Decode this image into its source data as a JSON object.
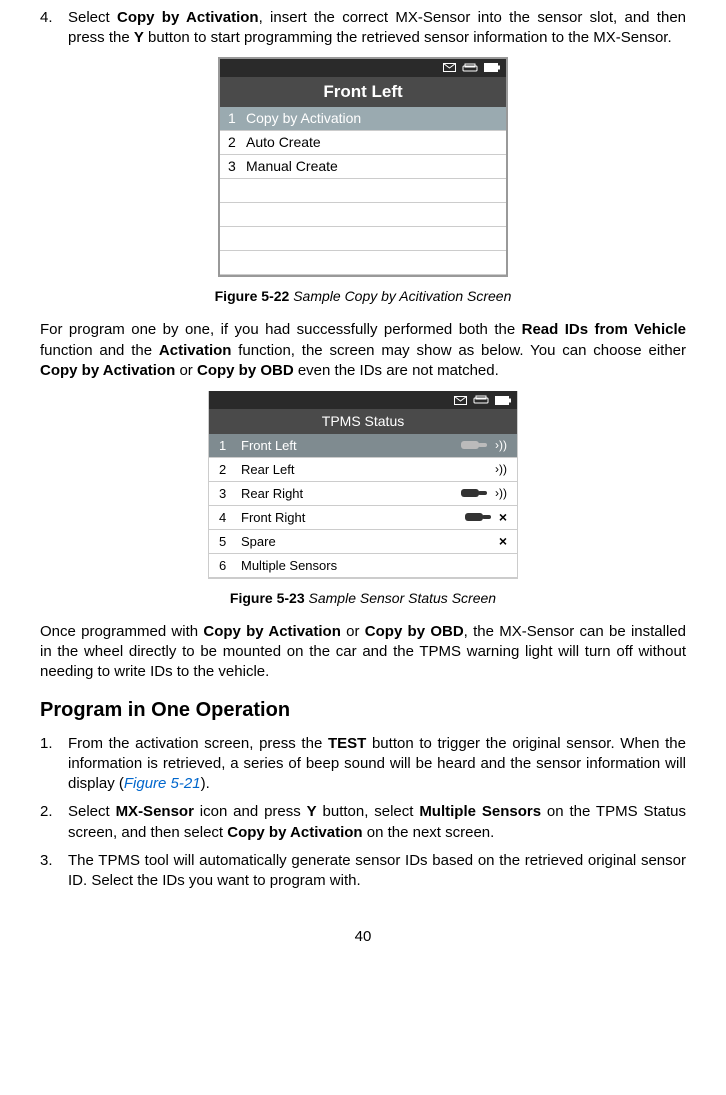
{
  "step4": {
    "num": "4.",
    "prefix": "Select ",
    "bold1": "Copy by Activation",
    "mid1": ", insert the correct MX-Sensor into the sensor slot, and then press the ",
    "bold2": "Y",
    "mid2": " button to start programming the retrieved sensor information to the MX-Sensor."
  },
  "device1": {
    "title": "Front Left",
    "rows": [
      {
        "num": "1",
        "label": "Copy by Activation",
        "selected": true
      },
      {
        "num": "2",
        "label": "Auto Create",
        "selected": false
      },
      {
        "num": "3",
        "label": "Manual Create",
        "selected": false
      }
    ]
  },
  "caption1": {
    "bold": "Figure 5-22",
    "italic": " Sample Copy by Acitivation Screen"
  },
  "para1": {
    "p1": "For program one by one, if you had successfully performed both the ",
    "b1": "Read IDs from Vehicle",
    "p2": " function and the ",
    "b2": "Activation",
    "p3": " function, the screen may show as below. You can choose either ",
    "b3": "Copy by Activation",
    "p4": " or ",
    "b4": "Copy by OBD",
    "p5": " even the IDs are not matched."
  },
  "device2": {
    "title": "TPMS Status",
    "rows": [
      {
        "num": "1",
        "label": "Front Left",
        "sensor": "light",
        "signal": true,
        "x": false,
        "selected": true
      },
      {
        "num": "2",
        "label": "Rear Left",
        "sensor": "none",
        "signal": true,
        "x": false,
        "selected": false
      },
      {
        "num": "3",
        "label": "Rear Right",
        "sensor": "dark",
        "signal": true,
        "x": false,
        "selected": false
      },
      {
        "num": "4",
        "label": "Front Right",
        "sensor": "dark",
        "signal": false,
        "x": true,
        "selected": false
      },
      {
        "num": "5",
        "label": "Spare",
        "sensor": "none",
        "signal": false,
        "x": true,
        "selected": false
      },
      {
        "num": "6",
        "label": "Multiple Sensors",
        "sensor": "none",
        "signal": false,
        "x": false,
        "selected": false
      }
    ]
  },
  "caption2": {
    "bold": "Figure 5-23",
    "italic": " Sample Sensor Status Screen"
  },
  "para2": {
    "p1": "Once programmed with ",
    "b1": "Copy by Activation",
    "p2": " or ",
    "b2": "Copy by OBD",
    "p3": ", the MX-Sensor can be installed in the wheel directly to be mounted on the car and the TPMS warning light will turn off without needing to write IDs to the vehicle."
  },
  "heading": "Program in One Operation",
  "step1b": {
    "num": "1.",
    "p1": "From the activation screen, press the ",
    "b1": "TEST",
    "p2": " button to trigger the original sensor. When the information is retrieved, a series of beep sound will be heard and the sensor information will display (",
    "link": "Figure 5-21",
    "p3": ")."
  },
  "step2b": {
    "num": "2.",
    "p1": "Select ",
    "b1": "MX-Sensor",
    "p2": " icon and press ",
    "b2": "Y",
    "p3": " button, select ",
    "b3": "Multiple Sensors",
    "p4": " on the TPMS Status screen, and then select ",
    "b4": "Copy by Activation",
    "p5": " on the next screen."
  },
  "step3b": {
    "num": "3.",
    "text": "The TPMS tool will automatically generate sensor IDs based on the retrieved original sensor ID. Select the IDs you want to program with."
  },
  "pageNum": "40"
}
